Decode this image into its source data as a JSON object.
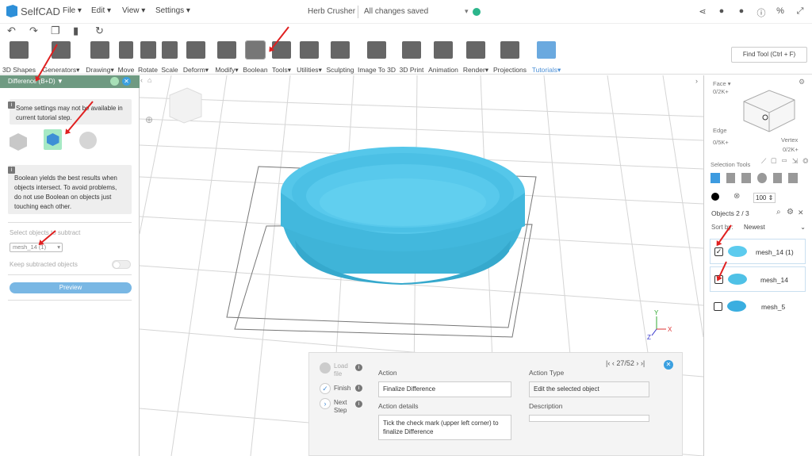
{
  "app": {
    "logo": "SelfCAD",
    "document_name": "Herb Crusher",
    "save_status": "All changes saved",
    "status_color": "#2cb58b"
  },
  "menus": [
    {
      "label": "File"
    },
    {
      "label": "Edit"
    },
    {
      "label": "View"
    },
    {
      "label": "Settings"
    }
  ],
  "top_icons": [
    "share-icon",
    "bell-icon",
    "user-icon",
    "info-icon",
    "percent-icon",
    "fullscreen-icon"
  ],
  "quick_icons": [
    "undo-icon",
    "redo-icon",
    "copy-icon",
    "delete-icon",
    "refresh-icon"
  ],
  "toolbar": [
    {
      "label": "3D Shapes"
    },
    {
      "label": "Generators"
    },
    {
      "label": "Drawing"
    },
    {
      "label": "Move"
    },
    {
      "label": "Rotate"
    },
    {
      "label": "Scale"
    },
    {
      "label": "Deform"
    },
    {
      "label": "Modify"
    },
    {
      "label": "Boolean"
    },
    {
      "label": "Tools"
    },
    {
      "label": "Utilities"
    },
    {
      "label": "Sculpting"
    },
    {
      "label": "Image To 3D"
    },
    {
      "label": "3D Print"
    },
    {
      "label": "Animation"
    },
    {
      "label": "Render"
    },
    {
      "label": "Projections"
    },
    {
      "label": "Tutorials"
    }
  ],
  "find_tool": "Find Tool (Ctrl + F)",
  "left_panel": {
    "title": "Difference (B+D)",
    "info1": "Some settings may not be available in current tutorial step.",
    "info2": "Boolean yields the best results when objects intersect. To avoid problems, do not use Boolean on objects just touching each other.",
    "subtract_label": "Select objects to subtract",
    "subtract_value": "mesh_14 (1)",
    "keep_label": "Keep subtracted objects",
    "preview": "Preview"
  },
  "right_panel": {
    "face_label": "Face",
    "face_count": "0/2K+",
    "edge_label": "Edge",
    "edge_count": "0/5K+",
    "vertex_label": "Vertex",
    "vertex_count": "0/2K+",
    "selection_tools": "Selection Tools",
    "opacity": "100",
    "objects_label": "Objects 2 / 3",
    "sort_label": "Sort by:",
    "sort_value": "Newest",
    "objects": [
      {
        "name": "mesh_14 (1)",
        "checked": true,
        "color": "#5ccbee"
      },
      {
        "name": "mesh_14",
        "checked": true,
        "color": "#4fc1e6"
      },
      {
        "name": "mesh_5",
        "checked": false,
        "color": "#4fc1e6"
      }
    ]
  },
  "tutorial": {
    "steps": [
      {
        "label": "Load file"
      },
      {
        "label": "Finish"
      },
      {
        "label": "Next Step"
      }
    ],
    "pager": "27/52",
    "action_label": "Action",
    "action_value": "Finalize Difference",
    "details_label": "Action details",
    "details_value": "Tick the check mark (upper left corner) to finalize Difference",
    "type_label": "Action Type",
    "type_value": "Edit the selected object",
    "description_label": "Description"
  },
  "axes": {
    "x": "X",
    "y": "Y",
    "z": "Z"
  }
}
